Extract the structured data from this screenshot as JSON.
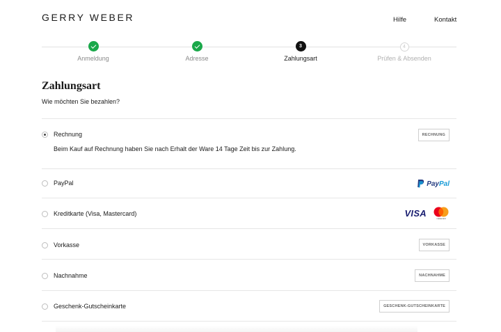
{
  "header": {
    "logo": "GERRY WEBER",
    "nav": {
      "help": "Hilfe",
      "contact": "Kontakt"
    }
  },
  "stepper": {
    "steps": [
      {
        "label": "Anmeldung",
        "state": "done",
        "marker": ""
      },
      {
        "label": "Adresse",
        "state": "done",
        "marker": ""
      },
      {
        "label": "Zahlungsart",
        "state": "active",
        "marker": "3"
      },
      {
        "label": "Prüfen & Absenden",
        "state": "todo",
        "marker": "4"
      }
    ]
  },
  "page": {
    "title": "Zahlungsart",
    "subtitle": "Wie möchten Sie bezahlen?"
  },
  "payment_options": [
    {
      "label": "Rechnung",
      "selected": true,
      "description": "Beim Kauf auf Rechnung haben Sie nach Erhalt der Ware 14 Tage Zeit bis zur Zahlung.",
      "badge": "RECHNUNG"
    },
    {
      "label": "PayPal",
      "selected": false,
      "logo": {
        "pay": "Pay",
        "pal": "Pal"
      }
    },
    {
      "label": "Kreditkarte (Visa, Mastercard)",
      "selected": false,
      "logos": {
        "visa": "VISA",
        "mastercard": "mastercard"
      }
    },
    {
      "label": "Vorkasse",
      "selected": false,
      "badge": "VORKASSE"
    },
    {
      "label": "Nachnahme",
      "selected": false,
      "badge": "NACHNAHME"
    },
    {
      "label": "Geschenk-Gutscheinkarte",
      "selected": false,
      "badge": "GESCHENK-GUTSCHEINKARTE"
    }
  ],
  "colors": {
    "step_done": "#1aa84a",
    "step_active": "#111111",
    "paypal_dark": "#253b80",
    "paypal_light": "#179bd7",
    "visa": "#1a1f71",
    "mastercard_red": "#eb001b",
    "mastercard_orange": "#f79e1b"
  }
}
